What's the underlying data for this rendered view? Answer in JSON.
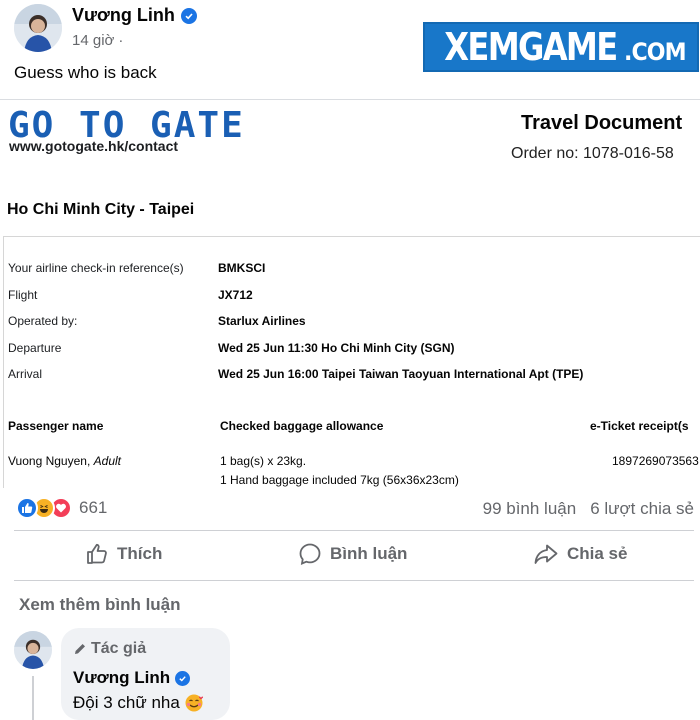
{
  "post": {
    "author": "Vương Linh",
    "time": "14 giờ",
    "separator": "·",
    "text": "Guess who is back"
  },
  "watermark": {
    "main": "XEMGAME",
    "suffix": ".COM"
  },
  "document": {
    "logo": "GO TO GATE",
    "logo_url": "www.gotogate.hk/contact",
    "title": "Travel Document",
    "order": "Order no: 1078-016-58",
    "route": "Ho Chi Minh City - Taipei",
    "details": [
      {
        "label": "Your airline check-in reference(s)",
        "value": "BMKSCI"
      },
      {
        "label": "Flight",
        "value": "JX712"
      },
      {
        "label": "Operated by:",
        "value": "Starlux Airlines"
      },
      {
        "label": "Departure",
        "value": "Wed 25 Jun 11:30  Ho Chi Minh City (SGN)"
      },
      {
        "label": "Arrival",
        "value": "Wed 25 Jun 16:00  Taipei Taiwan Taoyuan International Apt (TPE)"
      }
    ],
    "table": {
      "headers": [
        "Passenger name",
        "Checked baggage allowance",
        "e-Ticket receipt(s"
      ],
      "passenger_name": "Vuong Nguyen,",
      "passenger_type": "Adult",
      "baggage_line1": "1 bag(s) x 23kg.",
      "baggage_line2": "1 Hand baggage included 7kg (56x36x23cm)",
      "ticket": "1897269073563"
    }
  },
  "reactions": {
    "count": "661",
    "icons": [
      "like-icon",
      "haha-icon",
      "love-icon"
    ]
  },
  "stats": {
    "comments": "99 bình luận",
    "shares": "6 lượt chia sẻ"
  },
  "actions": {
    "like": "Thích",
    "comment": "Bình luận",
    "share": "Chia sẻ"
  },
  "more_comments": "Xem thêm bình luận",
  "comment": {
    "tag": "Tác giả",
    "author": "Vương Linh",
    "text": "Đội 3 chữ nha"
  },
  "colors": {
    "facebook_blue": "#1b74e4",
    "muted_text": "#65676b",
    "watermark_bg": "#1877c9"
  }
}
